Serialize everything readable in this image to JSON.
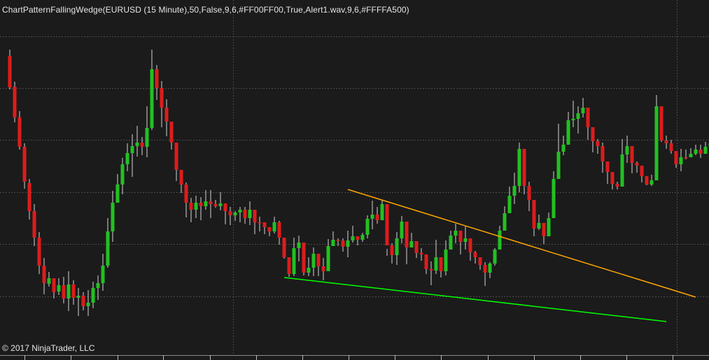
{
  "indicator": {
    "label": "ChartPatternFallingWedge(EURUSD (15 Minute),50,False,9,6,#FF00FF00,True,Alert1.wav,9,6,#FFFFA500)"
  },
  "copyright": {
    "text": "© 2017 NinjaTrader, LLC"
  },
  "colors": {
    "background": "#1b1b1b",
    "grid": "#4a4a4a",
    "up_candle": "#22c022",
    "down_candle": "#dd1c1c",
    "wick": "#d6d6d6",
    "upper_trendline": "#ffa500",
    "lower_trendline": "#00ff00",
    "text": "#e6e6e6"
  },
  "chart_data": {
    "type": "candlestick",
    "instrument": "EURUSD (15 Minute)",
    "pattern": "Falling Wedge",
    "y_direction": "price rising upward",
    "ohlc": [
      [
        80,
        125,
        71,
        128
      ],
      [
        124,
        168,
        117,
        175
      ],
      [
        168,
        210,
        159,
        214
      ],
      [
        210,
        260,
        205,
        270
      ],
      [
        262,
        302,
        256,
        314
      ],
      [
        302,
        340,
        292,
        352
      ],
      [
        340,
        380,
        332,
        392
      ],
      [
        380,
        405,
        369,
        421
      ],
      [
        406,
        398,
        389,
        410
      ],
      [
        398,
        418,
        405,
        427
      ],
      [
        417,
        408,
        398,
        422
      ],
      [
        408,
        427,
        396,
        434
      ],
      [
        427,
        407,
        388,
        445
      ],
      [
        407,
        426,
        401,
        436
      ],
      [
        426,
        423,
        412,
        452
      ],
      [
        423,
        438,
        418,
        444
      ],
      [
        438,
        433,
        415,
        452
      ],
      [
        433,
        412,
        403,
        441
      ],
      [
        412,
        405,
        394,
        429
      ],
      [
        405,
        380,
        363,
        416
      ],
      [
        380,
        331,
        312,
        383
      ],
      [
        331,
        290,
        273,
        346
      ],
      [
        290,
        264,
        249,
        286
      ],
      [
        264,
        235,
        226,
        278
      ],
      [
        235,
        219,
        205,
        245
      ],
      [
        219,
        209,
        192,
        253
      ],
      [
        209,
        204,
        180,
        224
      ],
      [
        204,
        210,
        196,
        222
      ],
      [
        210,
        183,
        152,
        225
      ],
      [
        183,
        99,
        71,
        186
      ],
      [
        99,
        126,
        93,
        143
      ],
      [
        126,
        154,
        116,
        182
      ],
      [
        154,
        174,
        142,
        195
      ],
      [
        174,
        204,
        186,
        214
      ],
      [
        204,
        243,
        210,
        259
      ],
      [
        243,
        264,
        258,
        276
      ],
      [
        264,
        290,
        261,
        311
      ],
      [
        290,
        300,
        283,
        318
      ],
      [
        300,
        290,
        280,
        312
      ],
      [
        290,
        295,
        282,
        315
      ],
      [
        295,
        288,
        272,
        300
      ],
      [
        288,
        292,
        272,
        312
      ],
      [
        292,
        295,
        286,
        297
      ],
      [
        295,
        291,
        275,
        301
      ],
      [
        291,
        302,
        291,
        321
      ],
      [
        302,
        308,
        296,
        322
      ],
      [
        308,
        304,
        302,
        316
      ],
      [
        304,
        300,
        296,
        318
      ],
      [
        300,
        312,
        296,
        320
      ],
      [
        312,
        300,
        288,
        322
      ],
      [
        300,
        318,
        300,
        335
      ],
      [
        318,
        318,
        310,
        331
      ],
      [
        318,
        325,
        320,
        335
      ],
      [
        325,
        331,
        327,
        338
      ],
      [
        331,
        318,
        310,
        334
      ],
      [
        318,
        340,
        316,
        350
      ],
      [
        340,
        368,
        341,
        370
      ],
      [
        368,
        392,
        378,
        396
      ],
      [
        392,
        355,
        340,
        395
      ],
      [
        355,
        347,
        337,
        374
      ],
      [
        347,
        390,
        387,
        394
      ],
      [
        390,
        383,
        368,
        395
      ],
      [
        383,
        363,
        354,
        395
      ],
      [
        363,
        381,
        368,
        395
      ],
      [
        381,
        388,
        369,
        401
      ],
      [
        388,
        352,
        342,
        354
      ],
      [
        352,
        343,
        331,
        351
      ],
      [
        343,
        344,
        341,
        352
      ],
      [
        344,
        353,
        341,
        360
      ],
      [
        353,
        344,
        330,
        368
      ],
      [
        344,
        338,
        323,
        347
      ],
      [
        338,
        343,
        340,
        351
      ],
      [
        343,
        336,
        333,
        346
      ],
      [
        336,
        313,
        308,
        341
      ],
      [
        313,
        307,
        287,
        328
      ],
      [
        307,
        315,
        296,
        320
      ],
      [
        315,
        292,
        287,
        312
      ],
      [
        292,
        351,
        356,
        366
      ],
      [
        351,
        365,
        348,
        377
      ],
      [
        365,
        341,
        332,
        379
      ],
      [
        341,
        317,
        309,
        348
      ],
      [
        317,
        354,
        346,
        378
      ],
      [
        354,
        345,
        333,
        354
      ],
      [
        345,
        362,
        353,
        369
      ],
      [
        362,
        364,
        355,
        373
      ],
      [
        364,
        385,
        369,
        392
      ],
      [
        385,
        387,
        374,
        408
      ],
      [
        387,
        368,
        343,
        392
      ],
      [
        368,
        388,
        374,
        397
      ],
      [
        388,
        357,
        344,
        394
      ],
      [
        357,
        337,
        330,
        349
      ],
      [
        337,
        330,
        320,
        348
      ],
      [
        330,
        346,
        341,
        364
      ],
      [
        346,
        341,
        324,
        357
      ],
      [
        341,
        361,
        348,
        373
      ],
      [
        361,
        368,
        359,
        377
      ],
      [
        368,
        379,
        370,
        386
      ],
      [
        379,
        390,
        375,
        409
      ],
      [
        390,
        377,
        375,
        398
      ],
      [
        377,
        357,
        355,
        380
      ],
      [
        357,
        330,
        323,
        353
      ],
      [
        330,
        305,
        295,
        328
      ],
      [
        305,
        280,
        267,
        299
      ],
      [
        280,
        266,
        247,
        292
      ],
      [
        266,
        213,
        204,
        275
      ],
      [
        213,
        266,
        257,
        278
      ],
      [
        266,
        286,
        260,
        302
      ],
      [
        286,
        327,
        323,
        338
      ],
      [
        327,
        319,
        307,
        329
      ],
      [
        319,
        338,
        331,
        349
      ],
      [
        338,
        312,
        304,
        333
      ],
      [
        312,
        256,
        245,
        310
      ],
      [
        256,
        217,
        177,
        251
      ],
      [
        217,
        207,
        194,
        222
      ],
      [
        207,
        172,
        160,
        189
      ],
      [
        172,
        170,
        144,
        182
      ],
      [
        170,
        162,
        152,
        191
      ],
      [
        162,
        154,
        140,
        168
      ],
      [
        154,
        182,
        175,
        200
      ],
      [
        182,
        202,
        184,
        218
      ],
      [
        202,
        209,
        199,
        220
      ],
      [
        209,
        231,
        204,
        247
      ],
      [
        231,
        246,
        235,
        263
      ],
      [
        246,
        263,
        247,
        271
      ],
      [
        263,
        267,
        260,
        271
      ],
      [
        267,
        221,
        199,
        225
      ],
      [
        221,
        209,
        194,
        233
      ],
      [
        209,
        233,
        219,
        248
      ],
      [
        233,
        237,
        231,
        247
      ],
      [
        237,
        252,
        240,
        261
      ],
      [
        252,
        264,
        254,
        265
      ],
      [
        264,
        258,
        250,
        266
      ],
      [
        258,
        152,
        136,
        255
      ],
      [
        152,
        201,
        156,
        203
      ],
      [
        201,
        205,
        194,
        213
      ],
      [
        205,
        216,
        200,
        220
      ],
      [
        216,
        235,
        225,
        240
      ],
      [
        235,
        225,
        213,
        245
      ],
      [
        225,
        225,
        214,
        228
      ],
      [
        225,
        220,
        212,
        221
      ],
      [
        220,
        214,
        207,
        222
      ],
      [
        214,
        220,
        207,
        226
      ],
      [
        220,
        210,
        203,
        219
      ],
      [
        210,
        205,
        194,
        217
      ]
    ],
    "upper_trendline": {
      "color": "orange",
      "start": {
        "bar": 69,
        "price": 271
      },
      "end": {
        "bar": 140,
        "price": 425
      }
    },
    "lower_trendline": {
      "color": "green",
      "start": {
        "bar": 56,
        "price": 397
      },
      "end": {
        "bar": 134,
        "price": 460
      }
    },
    "grid": true,
    "legend": "none"
  }
}
